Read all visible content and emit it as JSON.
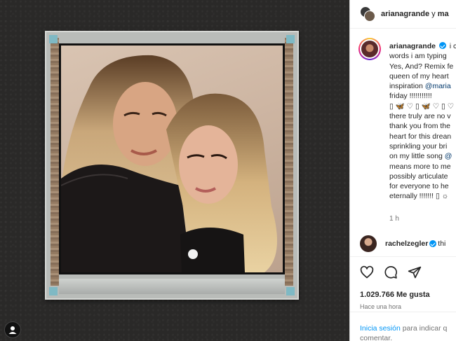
{
  "header": {
    "username": "arianagrande",
    "connector": "y",
    "truncated_second_user": "ma"
  },
  "caption": {
    "username": "arianagrande",
    "lines": [
      "i c",
      "words i am typing",
      "Yes, And? Remix fe",
      "queen of my heart",
      "inspiration",
      "friday !!!!!!!!!!!",
      "there truly are no v",
      "thank you from the",
      "heart for this drean",
      "sprinkling your bri",
      "on my little song",
      "means more to me",
      "possibly articulate",
      "for everyone to he",
      "eternally !!!!!!!"
    ],
    "mention_1": "@maria",
    "mention_2": "@",
    "emoji_line": "▯ 🦋 ♡ ▯ 🦋 ♡ ▯ ♡",
    "emoji_trail": "▯ ☼",
    "time": "1 h"
  },
  "comment": {
    "username": "rachelzegler",
    "rest": "thi"
  },
  "actions": {
    "likes": "1.029.766 Me gusta",
    "time_ago": "Hace una hora"
  },
  "login": {
    "link": "Inicia sesión",
    "rest_line1": "para indicar q",
    "rest_line2": "comentar."
  },
  "icons": [
    "heart-icon",
    "comment-icon",
    "share-icon",
    "verified-icon",
    "instagram-profile-icon"
  ],
  "colors": {
    "accent": "#0095f6",
    "mention": "#00376b",
    "background": "#2b2a29"
  }
}
